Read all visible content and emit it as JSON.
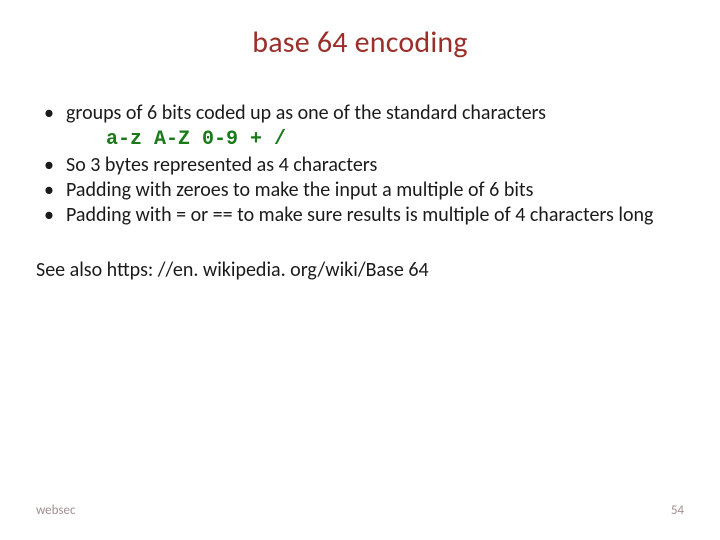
{
  "title": "base 64 encoding",
  "bullets": {
    "b1": "groups of 6 bits coded up as one of the standard characters",
    "code": "a-z A-Z 0-9 + /",
    "b2": "So 3 bytes represented as 4 characters",
    "b3": "Padding with zeroes to make the input a multiple of 6 bits",
    "b4": "Padding with = or == to make sure results is multiple of 4 characters long"
  },
  "see_also": "See also https: //en. wikipedia. org/wiki/Base 64",
  "footer": {
    "label": "websec",
    "page": "54"
  }
}
